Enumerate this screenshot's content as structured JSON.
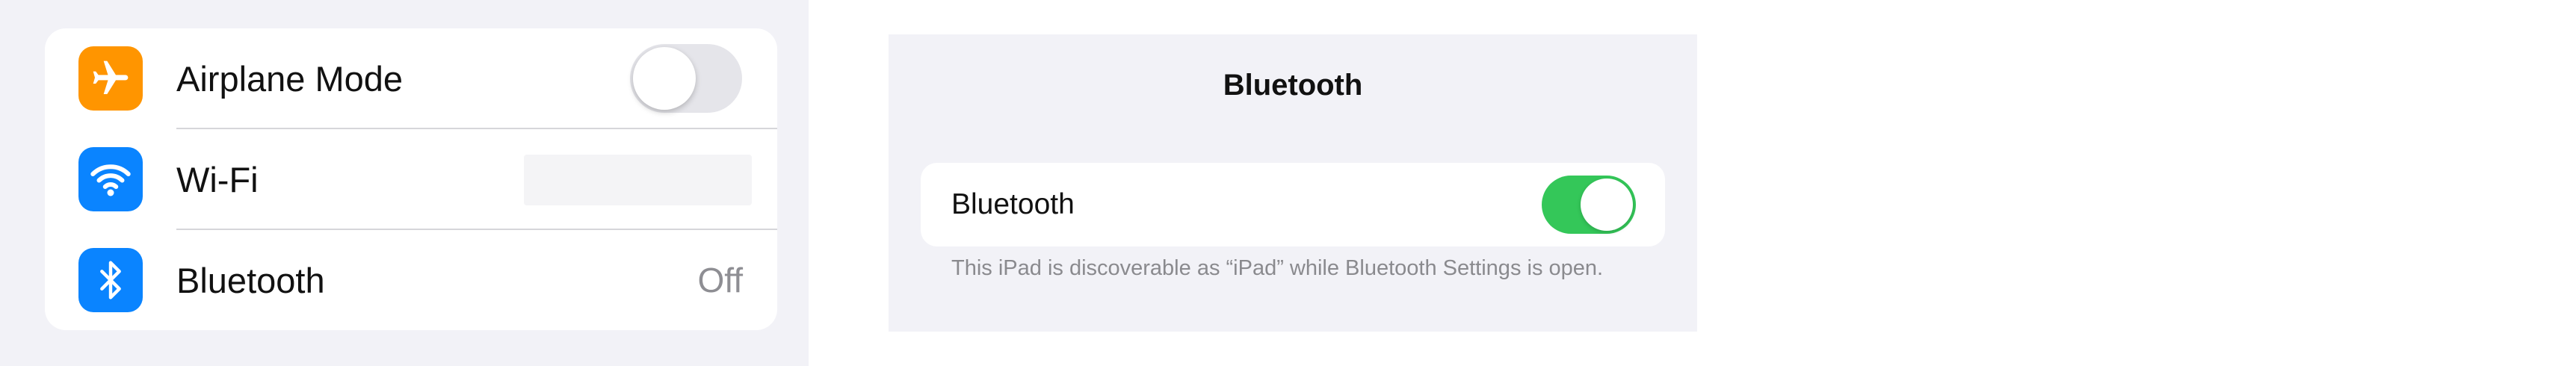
{
  "left_panel": {
    "rows": [
      {
        "label": "Airplane Mode",
        "icon": "airplane-icon",
        "icon_color": "#FF9500",
        "control": "toggle",
        "toggle_on": false
      },
      {
        "label": "Wi-Fi",
        "icon": "wifi-icon",
        "icon_color": "#0A84FF",
        "control": "value",
        "value": ""
      },
      {
        "label": "Bluetooth",
        "icon": "bluetooth-icon",
        "icon_color": "#0A84FF",
        "control": "value",
        "value": "Off"
      }
    ]
  },
  "right_panel": {
    "title": "Bluetooth",
    "card": {
      "label": "Bluetooth",
      "toggle_on": true,
      "toggle_color": "#34C759"
    },
    "footnote": "This iPad is discoverable as “iPad” while Bluetooth Settings is open."
  }
}
